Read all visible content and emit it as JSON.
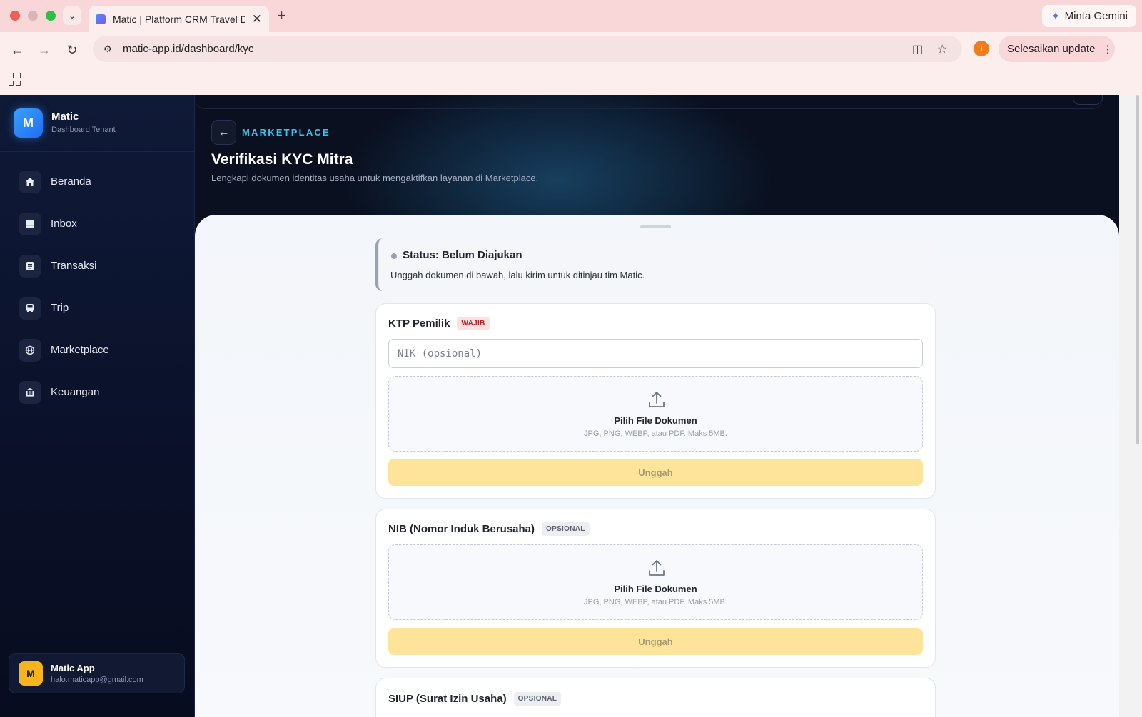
{
  "browser": {
    "tab_title": "Matic | Platform CRM Travel D",
    "url": "matic-app.id/dashboard/kyc",
    "gemini_label": "Minta Gemini",
    "update_label": "Selesaikan update",
    "profile_initial": "i"
  },
  "sidebar": {
    "brand_initial": "M",
    "brand_name": "Matic",
    "brand_sub": "Dashboard Tenant",
    "items": [
      {
        "label": "Beranda",
        "icon": "home-icon"
      },
      {
        "label": "Inbox",
        "icon": "inbox-icon"
      },
      {
        "label": "Transaksi",
        "icon": "receipt-icon"
      },
      {
        "label": "Trip",
        "icon": "bus-icon"
      },
      {
        "label": "Marketplace",
        "icon": "globe-icon"
      },
      {
        "label": "Keuangan",
        "icon": "bank-icon"
      }
    ],
    "user": {
      "initial": "M",
      "name": "Matic App",
      "email": "halo.maticapp@gmail.com"
    }
  },
  "header": {
    "eyebrow": "MARKETPLACE",
    "title": "Verifikasi KYC Mitra",
    "subtitle": "Lengkapi dokumen identitas usaha untuk mengaktifkan layanan di Marketplace."
  },
  "status": {
    "title": "Status: Belum Diajukan",
    "description": "Unggah dokumen di bawah, lalu kirim untuk ditinjau tim Matic."
  },
  "documents": [
    {
      "title": "KTP Pemilik",
      "badge": "WAJIB",
      "input_placeholder": "NIK (opsional)",
      "dropzone_title": "Pilih File Dokumen",
      "dropzone_hint": "JPG, PNG, WEBP, atau PDF. Maks 5MB.",
      "upload_label": "Unggah"
    },
    {
      "title": "NIB (Nomor Induk Berusaha)",
      "badge": "OPSIONAL",
      "dropzone_title": "Pilih File Dokumen",
      "dropzone_hint": "JPG, PNG, WEBP, atau PDF. Maks 5MB.",
      "upload_label": "Unggah"
    },
    {
      "title": "SIUP (Surat Izin Usaha)",
      "badge": "OPSIONAL"
    }
  ],
  "colors": {
    "accent_cyan": "#2fc4ee",
    "brand_blue": "#1e6ef0",
    "upload_disabled": "#fde49a",
    "required_badge": "#b3242a"
  }
}
